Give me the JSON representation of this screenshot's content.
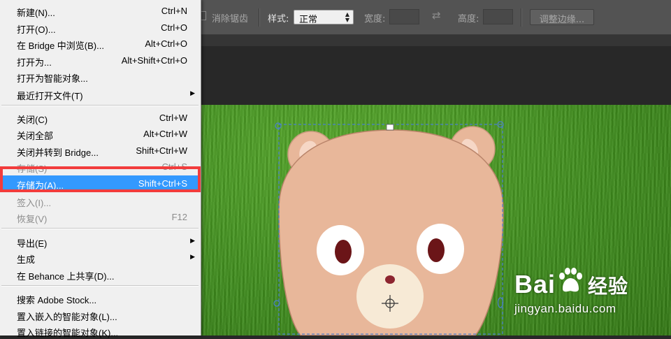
{
  "options_bar": {
    "antialias_label": "消除锯齿",
    "style_label": "样式:",
    "style_value": "正常",
    "width_label": "宽度:",
    "height_label": "高度:",
    "refine_edge_button": "调整边缘..."
  },
  "file_menu": {
    "items": [
      {
        "label": "新建(N)...",
        "shortcut": "Ctrl+N"
      },
      {
        "label": "打开(O)...",
        "shortcut": "Ctrl+O"
      },
      {
        "label": "在 Bridge 中浏览(B)...",
        "shortcut": "Alt+Ctrl+O"
      },
      {
        "label": "打开为...",
        "shortcut": "Alt+Shift+Ctrl+O"
      },
      {
        "label": "打开为智能对象...",
        "shortcut": ""
      },
      {
        "label": "最近打开文件(T)",
        "shortcut": ""
      },
      {
        "label": "关闭(C)",
        "shortcut": "Ctrl+W"
      },
      {
        "label": "关闭全部",
        "shortcut": "Alt+Ctrl+W"
      },
      {
        "label": "关闭并转到 Bridge...",
        "shortcut": "Shift+Ctrl+W"
      },
      {
        "label": "存储(S)",
        "shortcut": "Ctrl+S"
      },
      {
        "label": "存储为(A)...",
        "shortcut": "Shift+Ctrl+S"
      },
      {
        "label": "签入(I)...",
        "shortcut": ""
      },
      {
        "label": "恢复(V)",
        "shortcut": "F12"
      },
      {
        "label": "导出(E)",
        "shortcut": ""
      },
      {
        "label": "生成",
        "shortcut": ""
      },
      {
        "label": "在 Behance 上共享(D)...",
        "shortcut": ""
      },
      {
        "label": "搜索 Adobe Stock...",
        "shortcut": ""
      },
      {
        "label": "置入嵌入的智能对象(L)...",
        "shortcut": ""
      },
      {
        "label": "置入链接的智能对象(K)...",
        "shortcut": ""
      }
    ]
  },
  "watermark": {
    "logo_latin": "Bai",
    "logo_cn": "经验",
    "url": "jingyan.baidu.com"
  },
  "colors": {
    "menu_highlight": "#3399ff",
    "annotation_box": "#f23c3c"
  }
}
